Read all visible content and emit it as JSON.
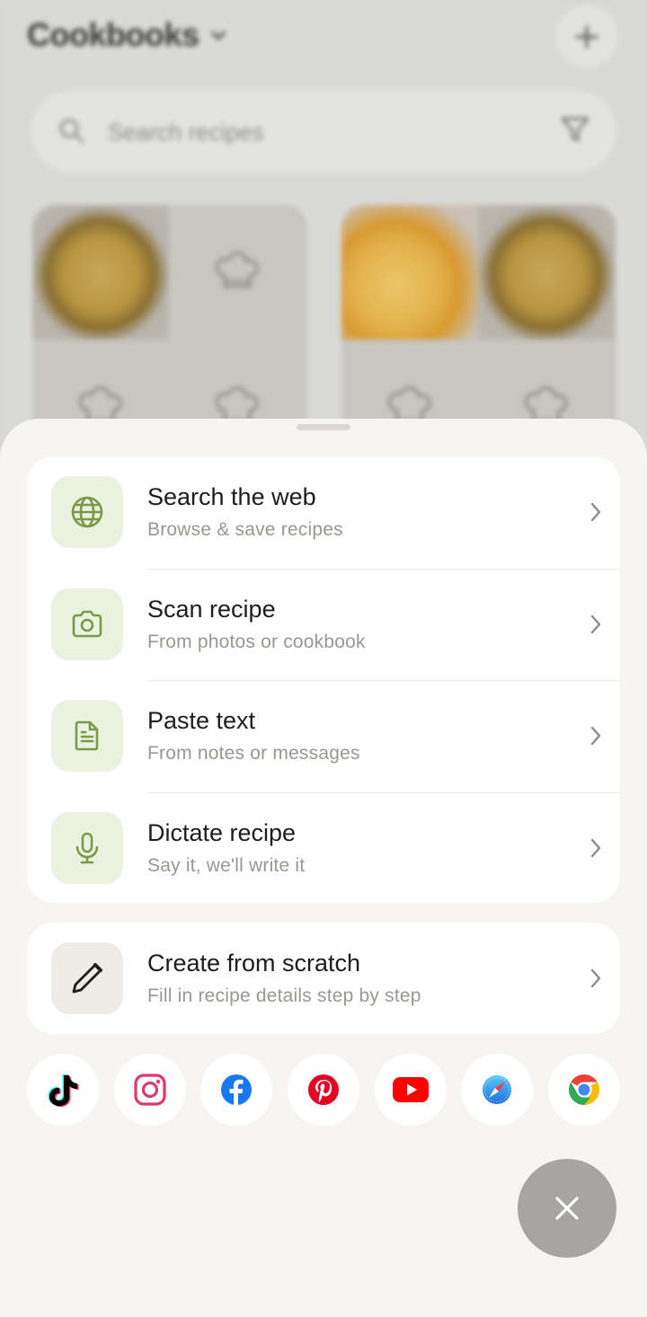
{
  "background": {
    "title": "Cookbooks",
    "search_placeholder": "Search recipes"
  },
  "sheet": {
    "import_options": [
      {
        "title": "Search the web",
        "subtitle": "Browse & save recipes",
        "icon": "globe-icon"
      },
      {
        "title": "Scan recipe",
        "subtitle": "From photos or cookbook",
        "icon": "camera-icon"
      },
      {
        "title": "Paste text",
        "subtitle": "From notes or messages",
        "icon": "document-icon"
      },
      {
        "title": "Dictate recipe",
        "subtitle": "Say it, we'll write it",
        "icon": "microphone-icon"
      }
    ],
    "create": {
      "title": "Create from scratch",
      "subtitle": "Fill in recipe details step by step",
      "icon": "pencil-icon"
    },
    "social_sources": [
      "tiktok-icon",
      "instagram-icon",
      "facebook-icon",
      "pinterest-icon",
      "youtube-icon",
      "safari-icon",
      "chrome-icon"
    ]
  },
  "colors": {
    "accent_green": "#7a9a4a",
    "icon_tile_green": "#ebf2e0",
    "subtitle_gray": "#9a978f",
    "sheet_bg": "#f6f5f2"
  }
}
